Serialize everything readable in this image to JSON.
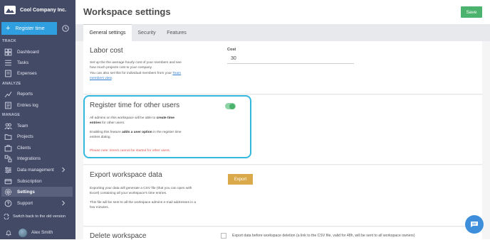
{
  "brand": {
    "name": "Cool Company Inc."
  },
  "sidebar": {
    "register_label": "Register time",
    "sections": {
      "track": "TRACK",
      "analyze": "ANALYZE",
      "manage": "MANAGE"
    },
    "items": [
      {
        "label": "Dashboard"
      },
      {
        "label": "Tasks"
      },
      {
        "label": "Expenses"
      },
      {
        "label": "Reports"
      },
      {
        "label": "Entries log"
      },
      {
        "label": "Team"
      },
      {
        "label": "Projects"
      },
      {
        "label": "Clients"
      },
      {
        "label": "Integrations"
      },
      {
        "label": "Data management"
      },
      {
        "label": "Subscription"
      },
      {
        "label": "Settings"
      },
      {
        "label": "Support"
      }
    ],
    "switch_label": "Switch back to the old version",
    "user_name": "Alex Smith"
  },
  "header": {
    "title": "Workspace settings",
    "save_label": "Save"
  },
  "tabs": [
    {
      "label": "General settings"
    },
    {
      "label": "Security"
    },
    {
      "label": "Features"
    }
  ],
  "labor_cost": {
    "title": "Labor cost",
    "desc1": "Set up the the average hourly cost of your members and see",
    "desc2": "how much projects cost to your company.",
    "desc3": "You can also set this for individual members from your",
    "link1": "Team",
    "link2": "members view",
    "cost_label": "Cost",
    "cost_value": "30"
  },
  "register_others": {
    "title": "Register time for other users",
    "line1_pre": "All admins on this workspace will be able to ",
    "line1_bold": "create time",
    "line2_bold": "entries",
    "line2_post": " for other users.",
    "line3_pre": "Enabling this feature ",
    "line3_bold": "adds a user option",
    "line3_post": " in the register time",
    "line4": "entries dialog.",
    "note": "Please note: timers cannot be started for other users.",
    "toggle_on": true
  },
  "export": {
    "title": "Export workspace data",
    "desc1": "Exporting your data will generate a CSV file (that you can open with",
    "desc2": "Excel) containing all your workspace's time entries.",
    "desc3": "This file will be sent to all the workspace admins e-mail addresses in a",
    "desc4": "few minutes.",
    "button_label": "Export"
  },
  "delete": {
    "title": "Delete workspace",
    "checkbox_label": "Export data before workspace deletion (a link to the CSV file, valid for 48h, will be sent to all workspace owners)"
  },
  "colors": {
    "sidebar": "#434a66",
    "register": "#2f9fe0",
    "save": "#4cb36e",
    "export": "#d9a94a",
    "highlight": "#35b8df",
    "note": "#d9534f"
  }
}
